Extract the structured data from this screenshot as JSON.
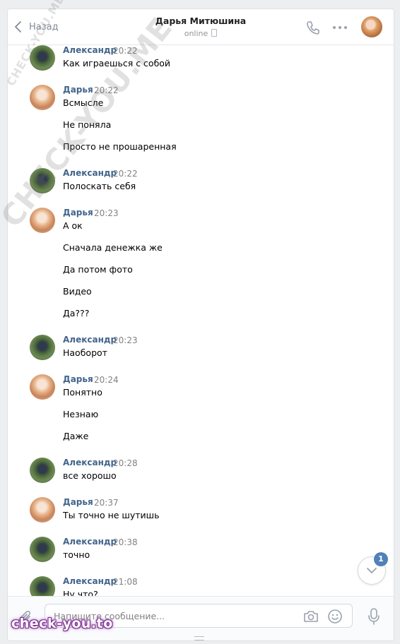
{
  "header": {
    "back_label": "Назад",
    "title": "Дарья Митюшина",
    "status": "online"
  },
  "messages": [
    {
      "author": "Александр",
      "time": "20:22",
      "texts": [
        "Как играешься с собой"
      ]
    },
    {
      "author": "Дарья",
      "time": "20:22",
      "texts": [
        "Всмысле",
        "Не поняла",
        "Просто не прошаренная"
      ]
    },
    {
      "author": "Александр",
      "time": "20:22",
      "texts": [
        "Полоскать себя"
      ]
    },
    {
      "author": "Дарья",
      "time": "20:23",
      "texts": [
        "А ок",
        "Сначала денежка же",
        "Да потом фото",
        "Видео",
        "Да???"
      ]
    },
    {
      "author": "Александр",
      "time": "20:23",
      "texts": [
        "Наоборот"
      ]
    },
    {
      "author": "Дарья",
      "time": "20:24",
      "texts": [
        "Понятно",
        "Незнаю",
        "Даже"
      ]
    },
    {
      "author": "Александр",
      "time": "20:28",
      "texts": [
        "все хорошо"
      ]
    },
    {
      "author": "Дарья",
      "time": "20:37",
      "texts": [
        "Ты точно не шутишь"
      ]
    },
    {
      "author": "Александр",
      "time": "20:38",
      "texts": [
        "точно"
      ]
    },
    {
      "author": "Александр",
      "time": "21:08",
      "texts": [
        "Ну что?"
      ]
    }
  ],
  "unread_count": "1",
  "composer": {
    "placeholder": "Напишите сообщение..."
  },
  "watermarks": {
    "small": "CHECK-YOU.ME",
    "large": "CHECK-YOU.ME",
    "logo": "check-you.to"
  },
  "colors": {
    "author_name": "#42648b",
    "accent": "#5181b8",
    "background": "#edeef0"
  },
  "icons": [
    "back-chevron-icon",
    "phone-icon",
    "more-dots-icon",
    "attach-icon",
    "camera-icon",
    "emoji-icon",
    "microphone-icon",
    "chevron-down-icon"
  ]
}
